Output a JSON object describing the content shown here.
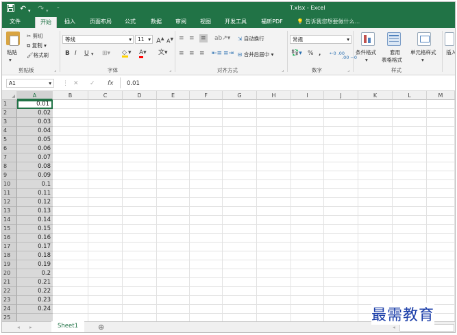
{
  "window": {
    "title": "T.xlsx - Excel"
  },
  "quick_access": {
    "save_icon": "save-icon",
    "undo_icon": "undo-icon",
    "redo_icon": "redo-icon",
    "customize_icon": "customize-icon"
  },
  "tabs": [
    {
      "label": "文件"
    },
    {
      "label": "开始"
    },
    {
      "label": "插入"
    },
    {
      "label": "页面布局"
    },
    {
      "label": "公式"
    },
    {
      "label": "数据"
    },
    {
      "label": "审阅"
    },
    {
      "label": "视图"
    },
    {
      "label": "开发工具"
    },
    {
      "label": "福昕PDF"
    }
  ],
  "tell_me": {
    "placeholder": "告诉我您想要做什么..."
  },
  "ribbon": {
    "clipboard": {
      "paste": "粘贴",
      "cut": "剪切",
      "copy": "复制",
      "format_painter": "格式刷",
      "group_label": "剪贴板"
    },
    "font": {
      "font_name": "等线",
      "font_size": "11",
      "bold": "B",
      "italic": "I",
      "underline": "U",
      "grow": "A",
      "shrink": "A",
      "color_letter": "A",
      "phonetic": "文",
      "group_label": "字体"
    },
    "alignment": {
      "wrap_text": "自动换行",
      "merge_center": "合并后居中",
      "group_label": "对齐方式"
    },
    "number": {
      "format": "常规",
      "percent": "%",
      "comma": ",",
      "inc_decimal": "←0 .00",
      "dec_decimal": ".00 →0",
      "group_label": "数字"
    },
    "styles": {
      "conditional": "条件格式",
      "table_line1": "套用",
      "table_line2": "表格格式",
      "cell_styles": "单元格样式",
      "group_label": "样式"
    },
    "cells": {
      "insert": "插入"
    },
    "accent_colors": {
      "fill": "#ffd200",
      "font": "#ff0000",
      "excel_green": "#217346"
    }
  },
  "formula_bar": {
    "name_box": "A1",
    "fx": "fx",
    "value": "0.01",
    "cancel": "✕",
    "enter": "✓"
  },
  "grid": {
    "columns": [
      "A",
      "B",
      "C",
      "D",
      "E",
      "F",
      "G",
      "H",
      "I",
      "J",
      "K",
      "L",
      "M"
    ],
    "rows": [
      "1",
      "2",
      "3",
      "4",
      "5",
      "6",
      "7",
      "8",
      "9",
      "10",
      "11",
      "12",
      "13",
      "14",
      "15",
      "16",
      "17",
      "18",
      "19",
      "20",
      "21",
      "22",
      "23",
      "24",
      "25"
    ],
    "column_a_values": [
      "0.01",
      "0.02",
      "0.03",
      "0.04",
      "0.05",
      "0.06",
      "0.07",
      "0.08",
      "0.09",
      "0.1",
      "0.11",
      "0.12",
      "0.13",
      "0.14",
      "0.15",
      "0.16",
      "0.17",
      "0.18",
      "0.19",
      "0.2",
      "0.21",
      "0.22",
      "0.23",
      "0.24",
      ""
    ]
  },
  "sheets": [
    {
      "label": "Sheet1"
    }
  ],
  "watermark": {
    "text": "最需教育"
  }
}
